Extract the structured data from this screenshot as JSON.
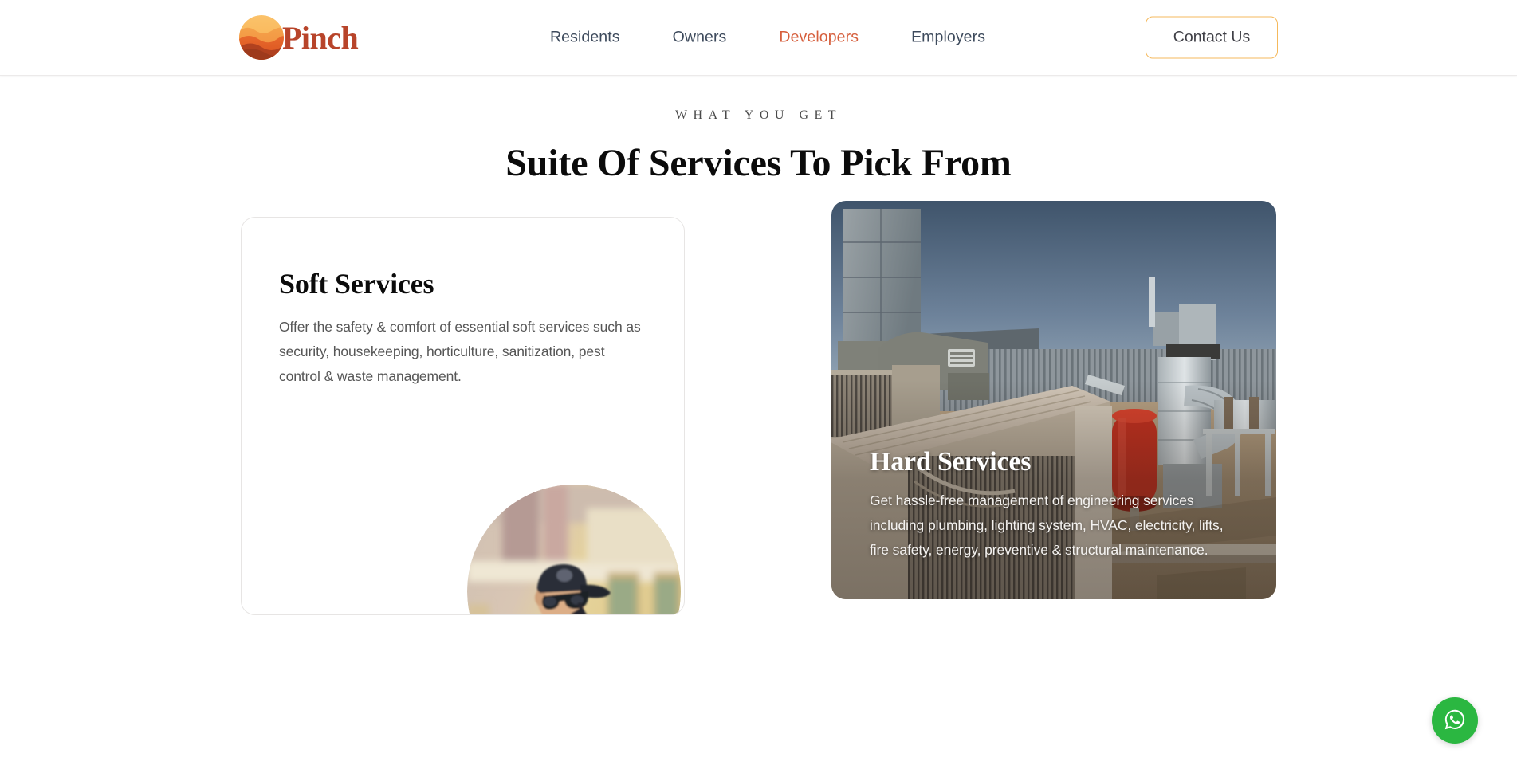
{
  "header": {
    "brand": {
      "name": "Pinch",
      "logo_icon": "pinch-wave-circle-logo"
    },
    "nav": [
      {
        "label": "Residents",
        "active": false
      },
      {
        "label": "Owners",
        "active": false
      },
      {
        "label": "Developers",
        "active": true
      },
      {
        "label": "Employers",
        "active": false
      }
    ],
    "contact_label": "Contact Us"
  },
  "section": {
    "eyebrow": "WHAT YOU GET",
    "title": "Suite Of Services To Pick From"
  },
  "cards": {
    "soft": {
      "title": "Soft Services",
      "body": "Offer the safety & comfort of essential soft services such as security, housekeeping, horticulture, sanitization, pest control & waste management.",
      "image_icon": "security-guard-photo"
    },
    "hard": {
      "title": "Hard Services",
      "body": "Get hassle-free management of engineering services including plumbing, lighting system, HVAC, electricity, lifts, fire safety, energy, preventive & structural maintenance.",
      "image_icon": "rooftop-hvac-plant-photo"
    }
  },
  "floating": {
    "whatsapp_icon": "whatsapp-icon"
  },
  "colors": {
    "brand": "#b8442a",
    "accent": "#d65f3d",
    "nav_text": "#3d4a5c",
    "button_border": "#f5b95c",
    "body_text": "#565656",
    "whatsapp_green": "#2bb741"
  }
}
